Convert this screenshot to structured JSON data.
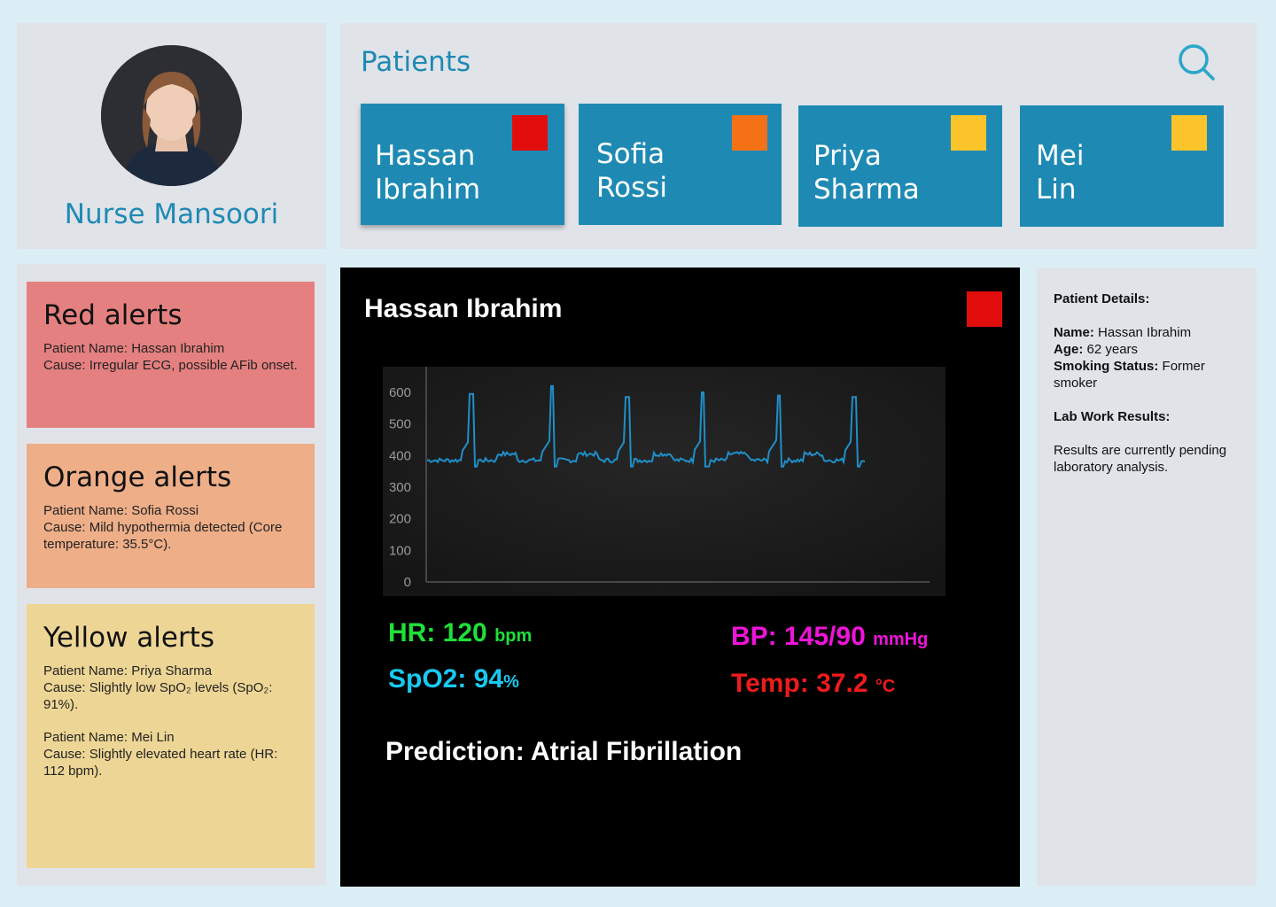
{
  "nurse": {
    "name": "Nurse Mansoori"
  },
  "header": {
    "title": "Patients",
    "search_icon": "search-icon"
  },
  "patients": [
    {
      "name": "Hassan\nIbrahim",
      "status_color": "#e20d0d"
    },
    {
      "name": "Sofia\nRossi",
      "status_color": "#f57115"
    },
    {
      "name": "Priya\nSharma",
      "status_color": "#fbc42a"
    },
    {
      "name": "Mei\nLin",
      "status_color": "#fbc42a"
    }
  ],
  "alerts": {
    "red": {
      "title": "Red alerts",
      "entries": [
        {
          "name": "Patient Name: Hassan Ibrahim",
          "cause": "Cause: Irregular ECG, possible AFib onset."
        }
      ]
    },
    "orange": {
      "title": "Orange alerts",
      "entries": [
        {
          "name": "Patient Name: Sofia Rossi",
          "cause": "Cause: Mild hypothermia detected (Core temperature: 35.5°C)."
        }
      ]
    },
    "yellow": {
      "title": "Yellow alerts",
      "entries": [
        {
          "name": "Patient Name: Priya Sharma",
          "cause": "Cause: Slightly low SpO₂ levels (SpO₂: 91%)."
        },
        {
          "name": "Patient Name: Mei Lin",
          "cause": "Cause: Slightly elevated heart rate (HR: 112 bpm)."
        }
      ]
    }
  },
  "monitor": {
    "patient_name": "Hassan Ibrahim",
    "status_color": "#e20d0d",
    "hr": {
      "label": "HR: 120",
      "unit": "bpm"
    },
    "spo2": {
      "label": "SpO2: 94",
      "unit": "%"
    },
    "bp": {
      "label": "BP: 145/90",
      "unit": "mmHg"
    },
    "temp": {
      "label": "Temp: 37.2",
      "unit": "°C"
    },
    "prediction": "Prediction: Atrial Fibrillation"
  },
  "chart_data": {
    "type": "line",
    "title": "",
    "xlabel": "",
    "ylabel": "",
    "ylim": [
      0,
      600
    ],
    "yticks": [
      0,
      100,
      200,
      300,
      400,
      500,
      600
    ],
    "grid": false,
    "series_color": "#1f8fc8",
    "beats": [
      {
        "x": 0.09,
        "y": 595
      },
      {
        "x": 0.25,
        "y": 620
      },
      {
        "x": 0.4,
        "y": 585
      },
      {
        "x": 0.55,
        "y": 600
      },
      {
        "x": 0.7,
        "y": 590
      },
      {
        "x": 0.85,
        "y": 585
      }
    ],
    "baseline": 385
  },
  "details": {
    "heading": "Patient Details:",
    "name_label": "Name:",
    "name": " Hassan Ibrahim",
    "age_label": "Age:",
    "age": " 62 years",
    "smoking_label": "Smoking Status:",
    "smoking": " Former smoker",
    "lab_heading": "Lab Work Results:",
    "lab_text": "Results are currently pending laboratory analysis."
  },
  "colors": {
    "accent": "#1e8ab4",
    "background": "#dbeef5"
  }
}
